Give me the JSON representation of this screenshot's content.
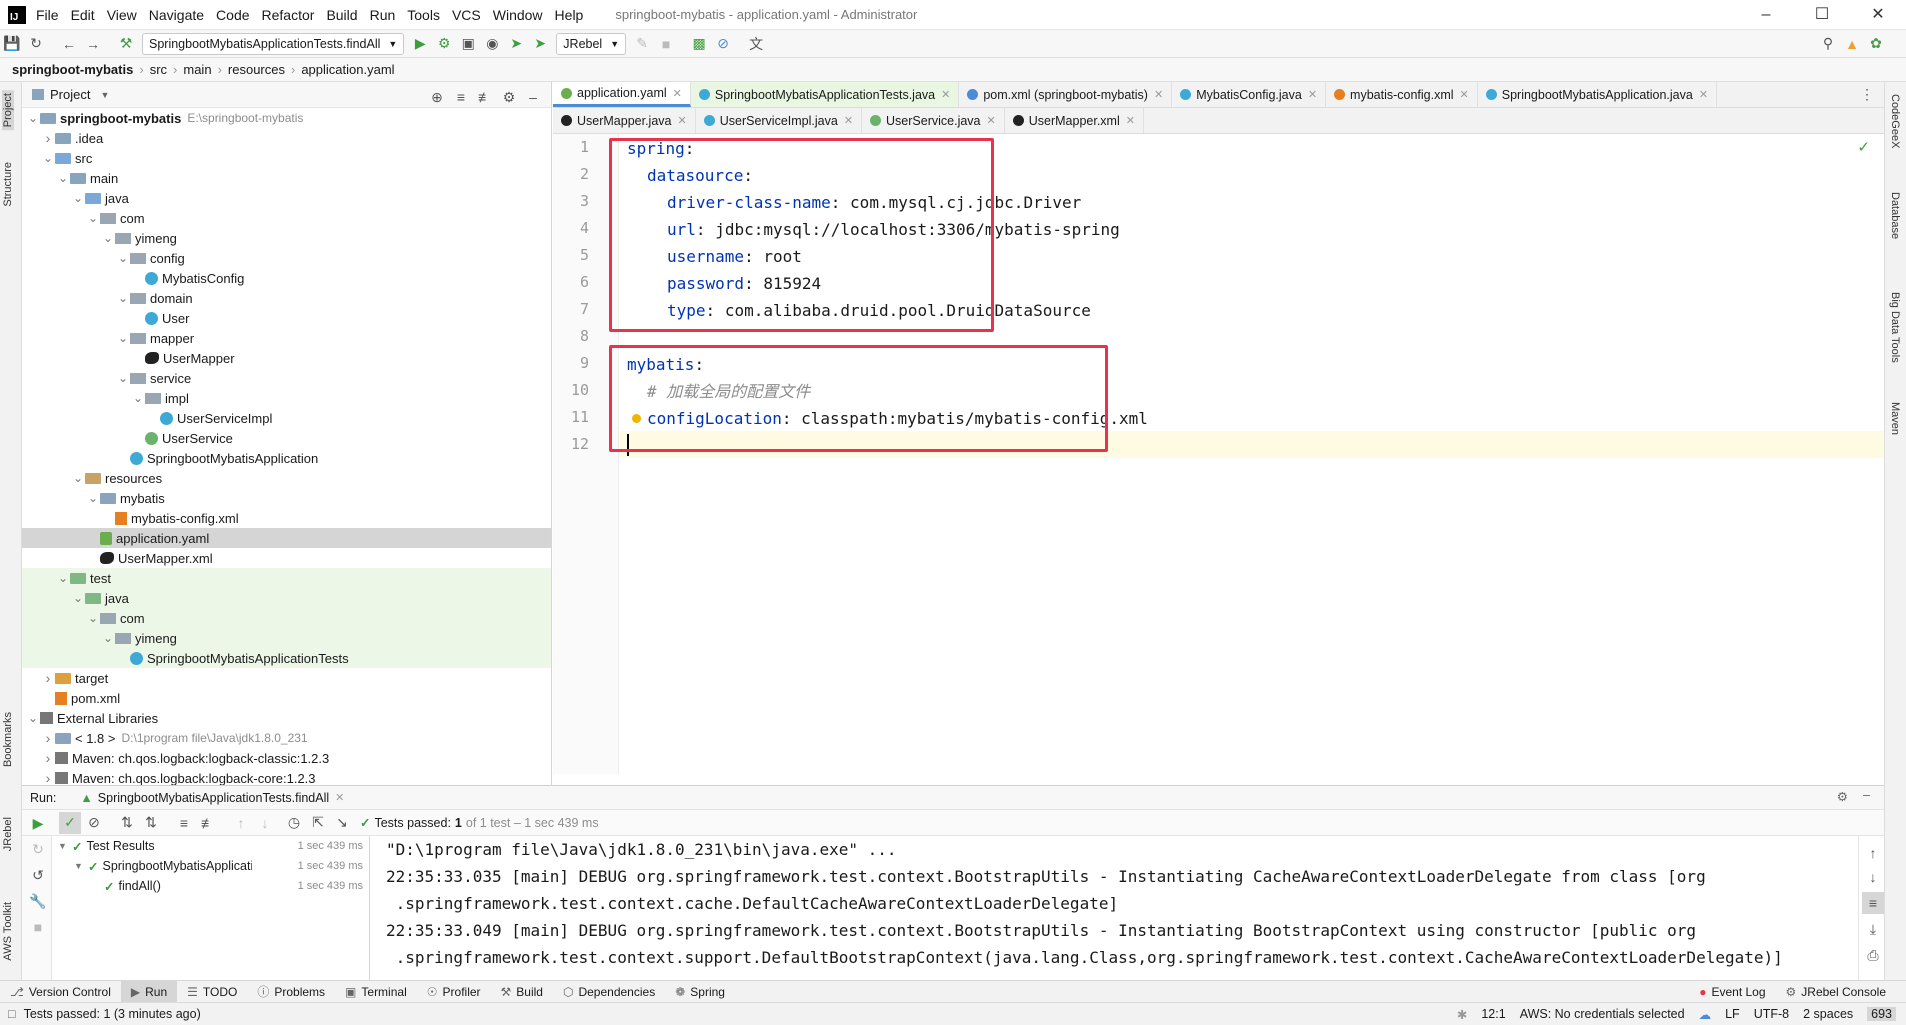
{
  "window": {
    "title": "springboot-mybatis - application.yaml - Administrator",
    "menu": [
      "File",
      "Edit",
      "View",
      "Navigate",
      "Code",
      "Refactor",
      "Build",
      "Run",
      "Tools",
      "VCS",
      "Window",
      "Help"
    ],
    "logo": "IJ"
  },
  "toolbar": {
    "run_config": "SpringbootMybatisApplicationTests.findAll",
    "jrebel": "JRebel"
  },
  "breadcrumb": [
    "springboot-mybatis",
    "src",
    "main",
    "resources",
    "application.yaml"
  ],
  "left_stripe": {
    "project": "Project",
    "structure": "Structure",
    "bookmarks": "Bookmarks",
    "jrebel": "JRebel",
    "aws": "AWS Toolkit"
  },
  "right_stripe": {
    "codegeex": "CodeGeeX",
    "database": "Database",
    "bigdata": "Big Data Tools",
    "maven": "Maven"
  },
  "project_panel": {
    "title": "Project",
    "tree": [
      {
        "label": "springboot-mybatis",
        "extra": "E:\\springboot-mybatis",
        "bold": true
      },
      {
        "label": ".idea"
      },
      {
        "label": "src"
      },
      {
        "label": "main"
      },
      {
        "label": "java"
      },
      {
        "label": "com"
      },
      {
        "label": "yimeng"
      },
      {
        "label": "config"
      },
      {
        "label": "MybatisConfig"
      },
      {
        "label": "domain"
      },
      {
        "label": "User"
      },
      {
        "label": "mapper"
      },
      {
        "label": "UserMapper"
      },
      {
        "label": "service"
      },
      {
        "label": "impl"
      },
      {
        "label": "UserServiceImpl"
      },
      {
        "label": "UserService"
      },
      {
        "label": "SpringbootMybatisApplication"
      },
      {
        "label": "resources"
      },
      {
        "label": "mybatis"
      },
      {
        "label": "mybatis-config.xml"
      },
      {
        "label": "application.yaml"
      },
      {
        "label": "UserMapper.xml"
      },
      {
        "label": "test"
      },
      {
        "label": "java"
      },
      {
        "label": "com"
      },
      {
        "label": "yimeng"
      },
      {
        "label": "SpringbootMybatisApplicationTests"
      },
      {
        "label": "target"
      },
      {
        "label": "pom.xml"
      },
      {
        "label": "External Libraries"
      },
      {
        "label": "< 1.8 >",
        "extra": "D:\\1program file\\Java\\jdk1.8.0_231"
      },
      {
        "label": "Maven: ch.qos.logback:logback-classic:1.2.3"
      },
      {
        "label": "Maven: ch.qos.logback:logback-core:1.2.3"
      }
    ]
  },
  "editor_tabs_row1": [
    {
      "label": "application.yaml",
      "active": true
    },
    {
      "label": "SpringbootMybatisApplicationTests.java",
      "modified": true
    },
    {
      "label": "pom.xml (springboot-mybatis)"
    },
    {
      "label": "MybatisConfig.java"
    },
    {
      "label": "mybatis-config.xml"
    },
    {
      "label": "SpringbootMybatisApplication.java"
    }
  ],
  "editor_tabs_row2": [
    {
      "label": "UserMapper.java"
    },
    {
      "label": "UserServiceImpl.java"
    },
    {
      "label": "UserService.java"
    },
    {
      "label": "UserMapper.xml"
    }
  ],
  "code": {
    "line_numbers": [
      "1",
      "2",
      "3",
      "4",
      "5",
      "6",
      "7",
      "8",
      "9",
      "10",
      "11",
      "12"
    ],
    "l1_key": "spring",
    "colon": ":",
    "l2_key": "datasource",
    "l3_key": "driver-class-name",
    "l3_val": "com.mysql.cj.jdbc.Driver",
    "l4_key": "url",
    "l4_val": "jdbc:mysql://localhost:3306/mybatis-spring",
    "l5_key": "username",
    "l5_val": "root",
    "l6_key": "password",
    "l6_val": "815924",
    "l7_key": "type",
    "l7_val": "com.alibaba.druid.pool.DruidDataSource",
    "l9_key": "mybatis",
    "l10_comment": "# 加载全局的配置文件",
    "l11_key": "configLocation",
    "l11_val": "classpath:mybatis/mybatis-config.xml"
  },
  "run_panel": {
    "label": "Run:",
    "config": "SpringbootMybatisApplicationTests.findAll",
    "status_prefix": "Tests passed:",
    "status_count": "1",
    "status_suffix": "of 1 test – 1 sec 439 ms",
    "tree": [
      {
        "label": "Test Results",
        "time": "1 sec 439 ms"
      },
      {
        "label": "SpringbootMybatisApplicatic",
        "time": "1 sec 439 ms"
      },
      {
        "label": "findAll()",
        "time": "1 sec 439 ms"
      }
    ],
    "console": [
      "\"D:\\1program file\\Java\\jdk1.8.0_231\\bin\\java.exe\" ...",
      "22:35:33.035 [main] DEBUG org.springframework.test.context.BootstrapUtils - Instantiating CacheAwareContextLoaderDelegate from class [org",
      " .springframework.test.context.cache.DefaultCacheAwareContextLoaderDelegate]",
      "22:35:33.049 [main] DEBUG org.springframework.test.context.BootstrapUtils - Instantiating BootstrapContext using constructor [public org",
      " .springframework.test.context.support.DefaultBootstrapContext(java.lang.Class,org.springframework.test.context.CacheAwareContextLoaderDelegate)]"
    ]
  },
  "bottom_tabs": [
    "Version Control",
    "Run",
    "TODO",
    "Problems",
    "Terminal",
    "Profiler",
    "Build",
    "Dependencies",
    "Spring"
  ],
  "bottom_right_tabs": [
    "Event Log",
    "JRebel Console"
  ],
  "status_bar": {
    "left": "Tests passed: 1 (3 minutes ago)",
    "position": "12:1",
    "aws": "AWS: No credentials selected",
    "line_sep": "LF",
    "encoding": "UTF-8",
    "indent": "2 spaces",
    "mem": "693"
  },
  "colors": {
    "accent": "#4a8cd8",
    "highlight_box": "#e8334c",
    "yaml_key": "#0033b3"
  }
}
